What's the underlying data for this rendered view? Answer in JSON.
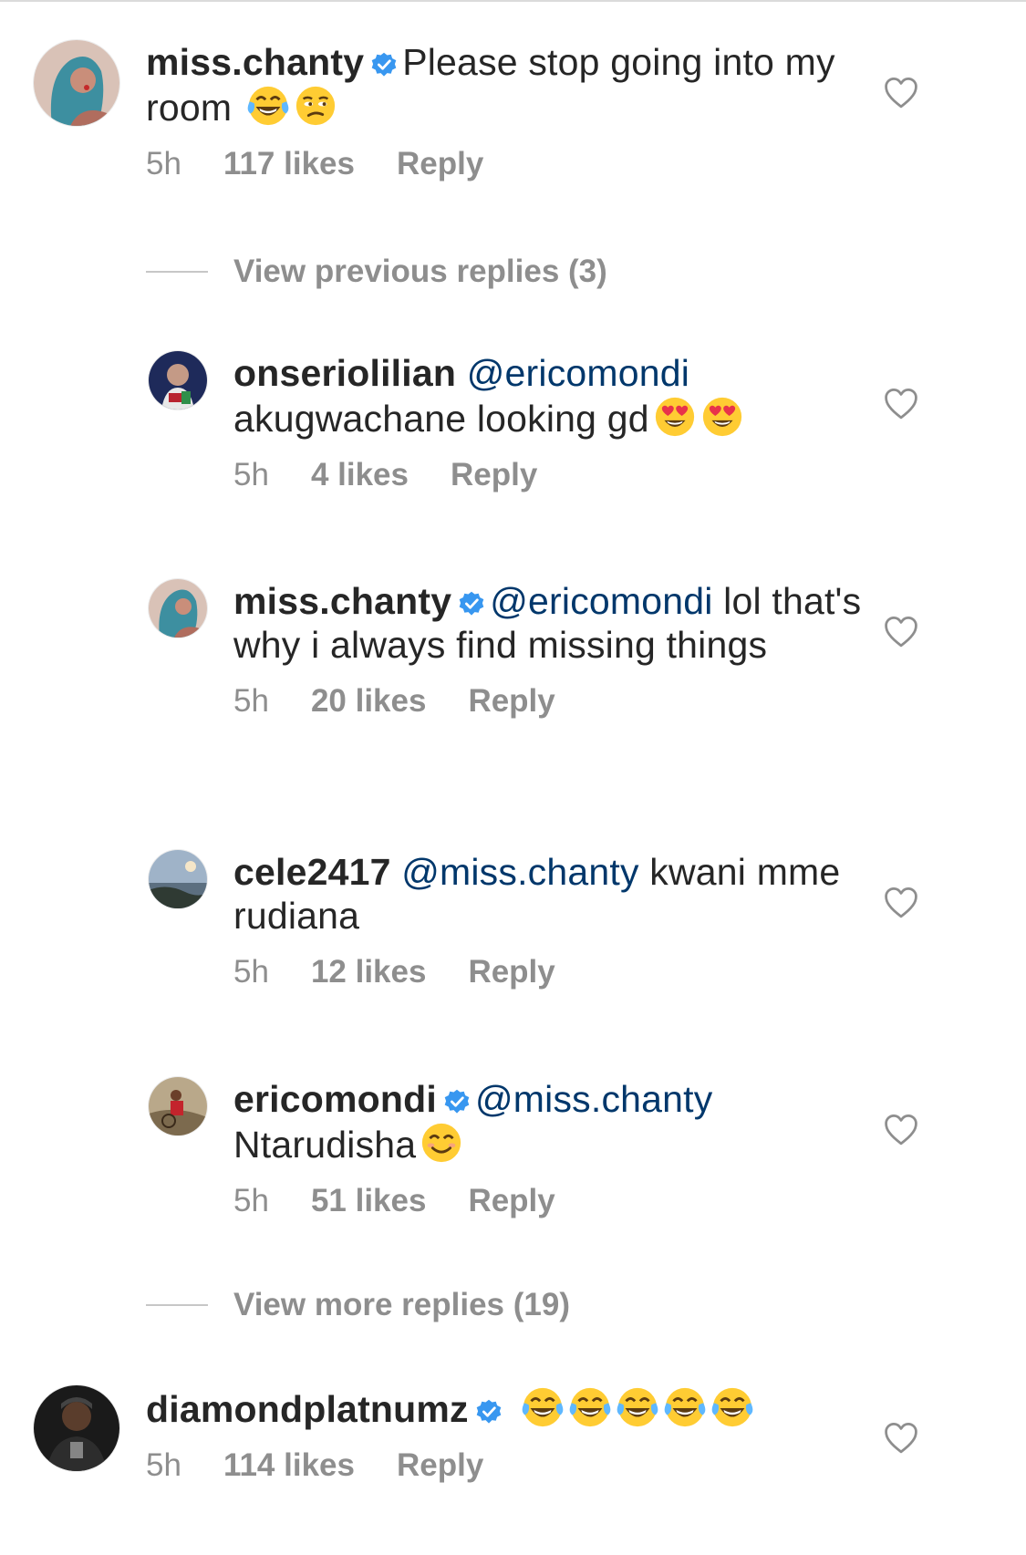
{
  "comments": [
    {
      "username": "miss.chanty",
      "verified": true,
      "mention": "",
      "text": "Please stop going into my room",
      "emojis": [
        "face-with-tears-of-joy",
        "unamused-face"
      ],
      "time": "5h",
      "likes": "117 likes",
      "reply": "Reply"
    }
  ],
  "view_previous": "View previous replies (3)",
  "replies": [
    {
      "username": "onseriolilian",
      "verified": false,
      "mention": "@ericomondi",
      "text": "akugwachane looking gd",
      "emojis": [
        "heart-eyes-face",
        "heart-eyes-face"
      ],
      "time": "5h",
      "likes": "4 likes",
      "reply": "Reply"
    },
    {
      "username": "miss.chanty",
      "verified": true,
      "mention": "@ericomondi",
      "text": "lol that's why i always find missing things",
      "emojis": [],
      "time": "5h",
      "likes": "20 likes",
      "reply": "Reply"
    },
    {
      "username": "cele2417",
      "verified": false,
      "mention": "@miss.chanty",
      "text": "kwani mme rudiana",
      "emojis": [],
      "time": "5h",
      "likes": "12 likes",
      "reply": "Reply"
    },
    {
      "username": "ericomondi",
      "verified": true,
      "mention": "@miss.chanty",
      "text": "Ntarudisha",
      "emojis": [
        "smiling-face"
      ],
      "time": "5h",
      "likes": "51 likes",
      "reply": "Reply"
    }
  ],
  "view_more": "View more replies (19)",
  "last_comment": {
    "username": "diamondplatnumz",
    "verified": true,
    "mention": "",
    "text": "",
    "emojis": [
      "face-with-tears-of-joy",
      "face-with-tears-of-joy",
      "face-with-tears-of-joy",
      "face-with-tears-of-joy",
      "face-with-tears-of-joy"
    ],
    "time": "5h",
    "likes": "114 likes",
    "reply": "Reply"
  },
  "colors": {
    "mention": "#00376b",
    "meta": "#8e8e8e",
    "verified": "#3897f0",
    "text": "#262626"
  }
}
